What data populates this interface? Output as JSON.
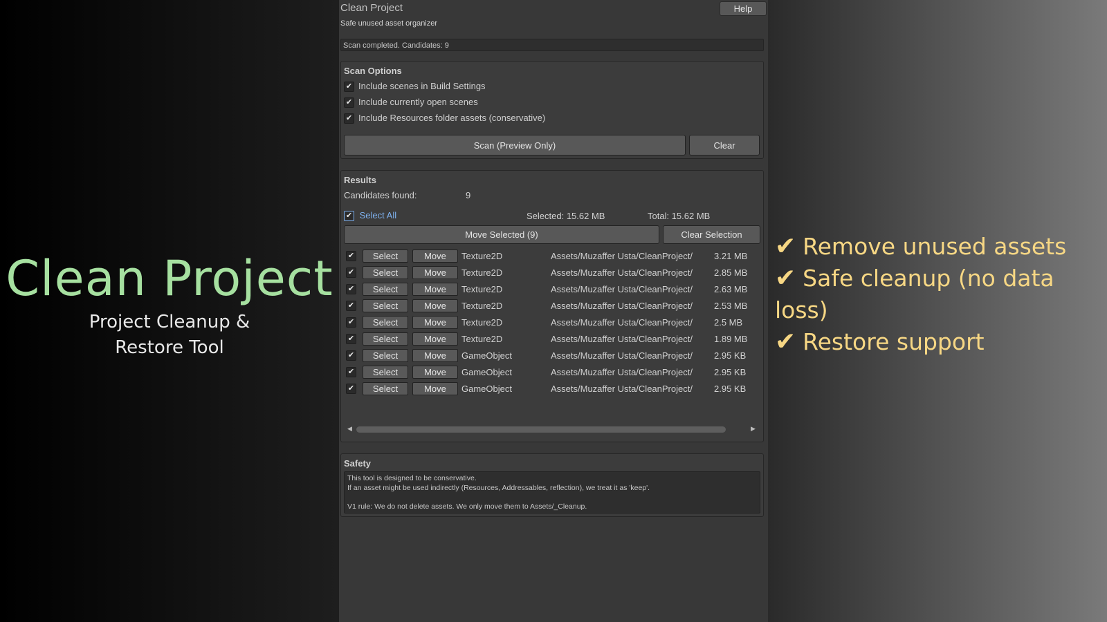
{
  "hero": {
    "title": "Clean Project",
    "subtitle_line1": "Project Cleanup &",
    "subtitle_line2": "Restore Tool"
  },
  "features": [
    {
      "icon": "check",
      "text": "Remove unused assets"
    },
    {
      "icon": "check",
      "text": "Safe cleanup (no data loss)"
    },
    {
      "icon": "check",
      "text": "Restore support"
    }
  ],
  "window": {
    "title": "Clean Project",
    "help_label": "Help",
    "subtitle": "Safe unused asset organizer",
    "status": "Scan completed. Candidates: 9"
  },
  "scan_options": {
    "title": "Scan Options",
    "options": [
      {
        "label": "Include scenes in Build Settings",
        "checked": true
      },
      {
        "label": "Include currently open scenes",
        "checked": true
      },
      {
        "label": "Include Resources folder assets (conservative)",
        "checked": true
      }
    ],
    "scan_label": "Scan (Preview Only)",
    "clear_label": "Clear"
  },
  "results": {
    "title": "Results",
    "candidates_label": "Candidates found:",
    "candidates_value": "9",
    "select_all_label": "Select All",
    "select_all_checked": true,
    "selected_size": "Selected: 15.62 MB",
    "total_size": "Total: 15.62 MB",
    "move_selected_label": "Move Selected (9)",
    "clear_selection_label": "Clear Selection",
    "select_btn": "Select",
    "move_btn": "Move",
    "rows": [
      {
        "checked": true,
        "type": "Texture2D",
        "path": "Assets/Muzaffer Usta/CleanProject/",
        "size": "3.21 MB"
      },
      {
        "checked": true,
        "type": "Texture2D",
        "path": "Assets/Muzaffer Usta/CleanProject/",
        "size": "2.85 MB"
      },
      {
        "checked": true,
        "type": "Texture2D",
        "path": "Assets/Muzaffer Usta/CleanProject/",
        "size": "2.63 MB"
      },
      {
        "checked": true,
        "type": "Texture2D",
        "path": "Assets/Muzaffer Usta/CleanProject/",
        "size": "2.53 MB"
      },
      {
        "checked": true,
        "type": "Texture2D",
        "path": "Assets/Muzaffer Usta/CleanProject/",
        "size": "2.5 MB"
      },
      {
        "checked": true,
        "type": "Texture2D",
        "path": "Assets/Muzaffer Usta/CleanProject/",
        "size": "1.89 MB"
      },
      {
        "checked": true,
        "type": "GameObject",
        "path": "Assets/Muzaffer Usta/CleanProject/",
        "size": "2.95 KB"
      },
      {
        "checked": true,
        "type": "GameObject",
        "path": "Assets/Muzaffer Usta/CleanProject/",
        "size": "2.95 KB"
      },
      {
        "checked": true,
        "type": "GameObject",
        "path": "Assets/Muzaffer Usta/CleanProject/",
        "size": "2.95 KB"
      }
    ]
  },
  "safety": {
    "title": "Safety",
    "line1": "This tool is designed to be conservative.",
    "line2": "If an asset might be used indirectly (Resources, Addressables, reflection), we treat it as 'keep'.",
    "line3": "V1 rule: We do not delete assets. We only move them to Assets/_Cleanup."
  },
  "colors": {
    "hero_title": "#a6e0a0",
    "feature_text": "#f7d784",
    "editor_bg": "#383838",
    "select_all_link": "#7fb2f0"
  }
}
